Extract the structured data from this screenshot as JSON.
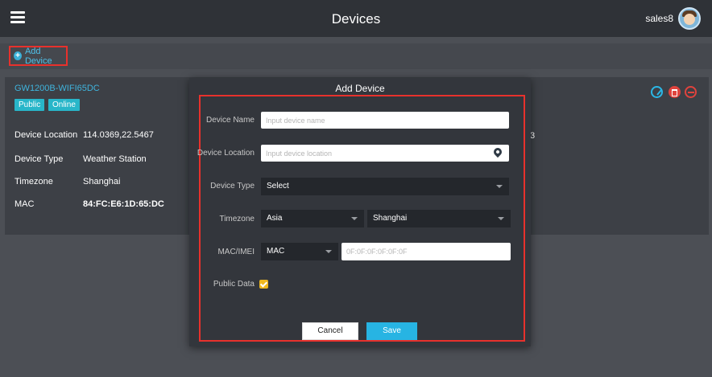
{
  "header": {
    "title": "Devices",
    "username": "sales8"
  },
  "toolbar": {
    "add_device_label": "Add Device"
  },
  "device": {
    "name": "GW1200B-WIFI65DC",
    "badges": [
      "Public",
      "Online"
    ],
    "info": [
      {
        "key": "Device Location",
        "value": "114.0369,22.5467"
      },
      {
        "key": "Device Type",
        "value": "Weather Station"
      },
      {
        "key": "Timezone",
        "value": "Shanghai"
      },
      {
        "key": "MAC",
        "value": "84:FC:E6:1D:65:DC"
      }
    ],
    "partially_hidden_text": "3",
    "actions": [
      "edit-icon",
      "delete-icon",
      "remove-icon"
    ],
    "colors": {
      "link": "#3fb4dd",
      "badge": "#28b6c9",
      "danger": "#e0433d"
    }
  },
  "modal": {
    "title": "Add Device",
    "fields": {
      "device_name": {
        "label": "Device Name",
        "placeholder": "Input device name",
        "value": ""
      },
      "device_location": {
        "label": "Device Location",
        "placeholder": "Input device location",
        "value": "",
        "icon": "location-pin-icon"
      },
      "device_type": {
        "label": "Device Type",
        "selected": "Select"
      },
      "timezone": {
        "label": "Timezone",
        "region": "Asia",
        "city": "Shanghai"
      },
      "mac_imei": {
        "label": "MAC/IMEI",
        "selected": "MAC",
        "placeholder": "0F:0F:0F:0F:0F:0F",
        "value": ""
      },
      "public_data": {
        "label": "Public Data",
        "checked": true
      }
    },
    "buttons": {
      "cancel": "Cancel",
      "save": "Save"
    },
    "colors": {
      "primary": "#27b4e3",
      "checkbox": "#f0b81e",
      "highlight": "#e8312c"
    }
  }
}
